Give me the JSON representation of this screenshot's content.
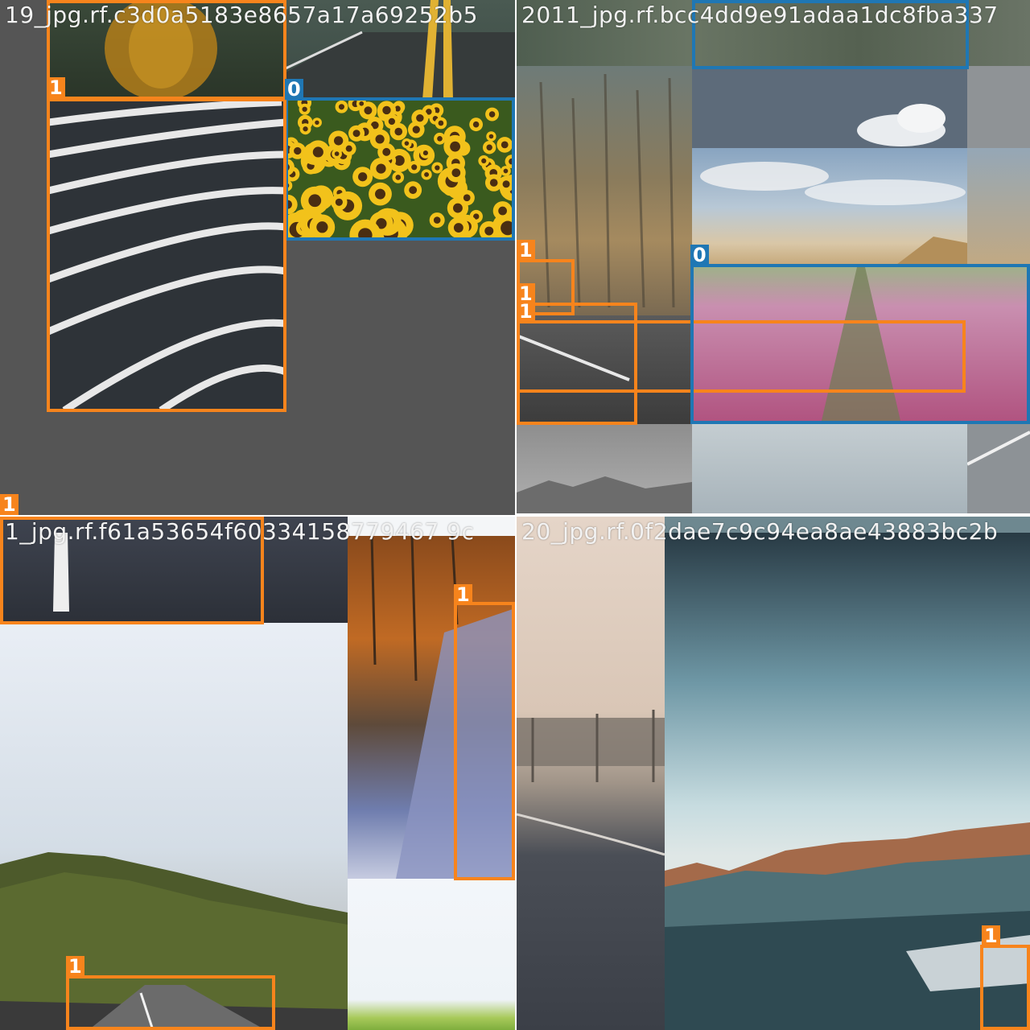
{
  "mosaic": {
    "colors": {
      "class_1": "#f7841c",
      "class_0": "#1f77b4",
      "background": "#555555",
      "filename_text": "#f2f2f2"
    },
    "tiles": [
      {
        "filename": "19_jpg.rf.c3d0a5183e8657a17a69252b5",
        "labels": [
          "1",
          "0",
          "1"
        ]
      },
      {
        "filename": "2011_jpg.rf.bcc4dd9e91adaa1dc8fba337",
        "labels": [
          "1",
          "1",
          "1",
          "0"
        ]
      },
      {
        "filename": "1_jpg.rf.f61a53654f60334158779467 9c",
        "labels": [
          "1",
          "1"
        ]
      },
      {
        "filename": "20_jpg.rf.0f2dae7c9c94ea8ae43883bc2b",
        "labels": [
          "1"
        ]
      }
    ]
  }
}
